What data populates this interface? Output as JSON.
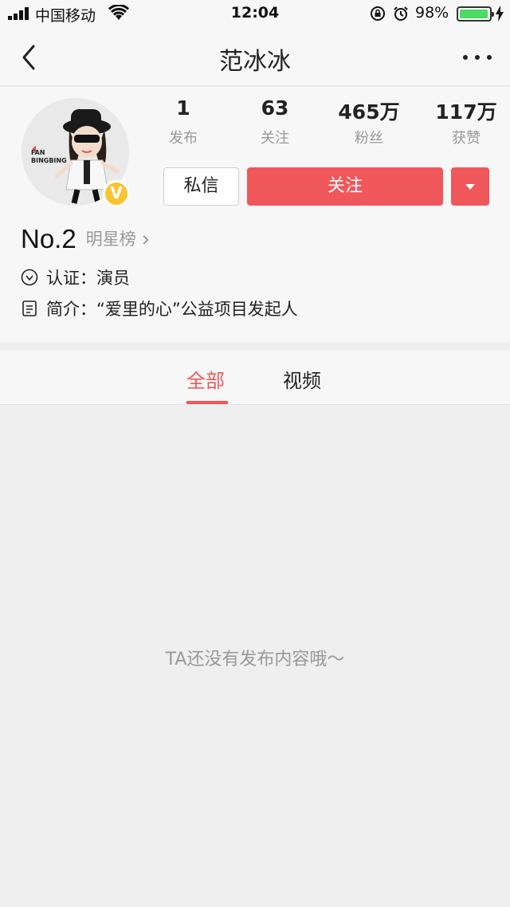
{
  "status_bar": {
    "carrier": "中国移动",
    "time": "12:04",
    "battery_percent": "98%",
    "battery_level": 0.98
  },
  "nav": {
    "title": "范冰冰"
  },
  "profile": {
    "avatar_text": "FAN BINGBING",
    "verified_badge": "V",
    "stats": [
      {
        "value": "1",
        "label": "发布"
      },
      {
        "value": "63",
        "label": "关注"
      },
      {
        "value": "465万",
        "label": "粉丝"
      },
      {
        "value": "117万",
        "label": "获赞"
      }
    ],
    "message_button": "私信",
    "follow_button": "关注",
    "rank": {
      "number": "No.2",
      "list": "明星榜"
    },
    "verification": "认证：演员",
    "intro": "简介：“爱里的心”公益项目发起人"
  },
  "tabs": [
    {
      "label": "全部",
      "active": true
    },
    {
      "label": "视频",
      "active": false
    }
  ],
  "empty_message": "TA还没有发布内容哦～",
  "colors": {
    "accent": "#f0575a",
    "muted_text": "#999999",
    "background": "#efefef"
  }
}
